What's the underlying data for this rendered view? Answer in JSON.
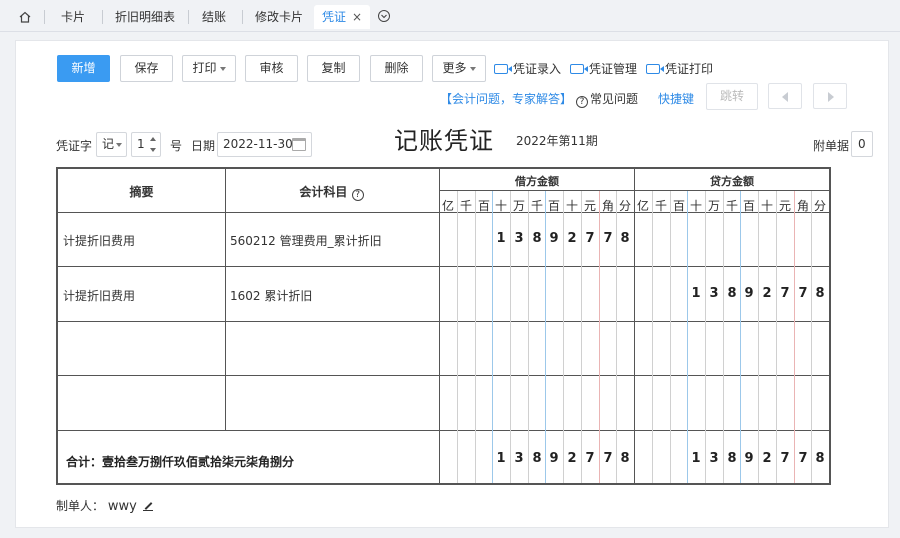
{
  "tabs": [
    {
      "label": "卡片"
    },
    {
      "label": "折旧明细表"
    },
    {
      "label": "结账"
    },
    {
      "label": "修改卡片"
    },
    {
      "label": "凭证",
      "active": true
    }
  ],
  "tab_close": "×",
  "toolbar": {
    "new": "新增",
    "save": "保存",
    "print": "打印",
    "audit": "审核",
    "copy": "复制",
    "delete": "删除",
    "more": "更多",
    "voucher_entry": "凭证录入",
    "voucher_manage": "凭证管理",
    "voucher_print": "凭证打印"
  },
  "help": {
    "expert": "【会计问题，专家解答】",
    "faq": "常见问题",
    "shortcut": "快捷键",
    "jump": "跳转"
  },
  "voucher": {
    "word_label": "凭证字",
    "word_value": "记",
    "number_value": "1",
    "number_suffix": "号",
    "date_label": "日期",
    "date_value": "2022-11-30",
    "title": "记账凭证",
    "period": "2022年第11期",
    "attach_label": "附单据",
    "attach_value": "0"
  },
  "table": {
    "col_summary": "摘要",
    "col_account": "会计科目",
    "col_debit": "借方金额",
    "col_credit": "贷方金额",
    "units": [
      "亿",
      "千",
      "百",
      "十",
      "万",
      "千",
      "百",
      "十",
      "元",
      "角",
      "分"
    ],
    "rows": [
      {
        "summary": "计提折旧费用",
        "account": "560212 管理费用_累计折旧",
        "debit": "13892778",
        "credit": ""
      },
      {
        "summary": "计提折旧费用",
        "account": "1602 累计折旧",
        "debit": "",
        "credit": "13892778"
      },
      {
        "summary": "",
        "account": "",
        "debit": "",
        "credit": ""
      },
      {
        "summary": "",
        "account": "",
        "debit": "",
        "credit": ""
      }
    ],
    "total_label": "合计：壹拾叁万捌仟玖佰贰拾柒元柒角捌分",
    "total_debit": "13892778",
    "total_credit": "13892778"
  },
  "maker": {
    "label": "制单人：",
    "value": "wwy"
  },
  "colors": {
    "primary": "#3a9bf2",
    "link": "#2e8ae6"
  }
}
